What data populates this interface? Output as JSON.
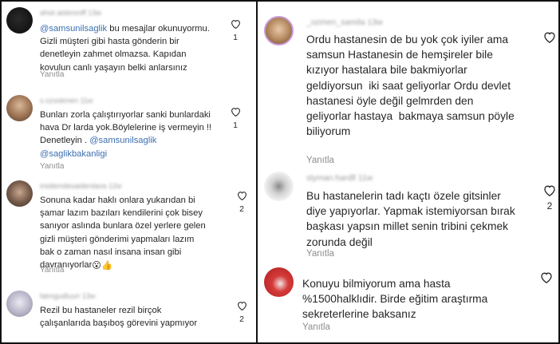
{
  "left_panel": {
    "comments": [
      {
        "username": "ahsir.aisbroniff  13w",
        "lines": [
          [
            {
              "t": "@samsunilsaglik",
              "m": true
            },
            {
              "t": " bu mesajlar okunuyormu."
            }
          ],
          [
            {
              "t": "Gizli müşteri gibi hasta gönderin bir"
            }
          ],
          [
            {
              "t": "denetleyin zahmet olmazsa. Kapıdan"
            }
          ],
          [
            {
              "t": "kovulun canlı yaşayın belki anlarsınız"
            }
          ]
        ],
        "reply": "Yanıtla",
        "likes": "1"
      },
      {
        "username": "s.ozsokmen  11w",
        "lines": [
          [
            {
              "t": "Bunları zorla çalıştırıyorlar sanki bunlardaki"
            }
          ],
          [
            {
              "t": "hava Dr larda yok.Böylelerine iş vermeyin !!"
            }
          ],
          [
            {
              "t": "Denetleyin . "
            },
            {
              "t": "@samsunilsaglik",
              "m": true
            }
          ],
          [
            {
              "t": "@saglikbakanligi",
              "m": true
            }
          ]
        ],
        "reply": "Yanıtla",
        "likes": "1"
      },
      {
        "username": "irsidemdesaiderdaoa  12w",
        "lines": [
          [
            {
              "t": "Sonuna kadar haklı onlara yukarıdan bi"
            }
          ],
          [
            {
              "t": "şamar lazım bazıları kendilerini çok bisey"
            }
          ],
          [
            {
              "t": "sanıyor aslında bunlara özel yerlere gelen"
            }
          ],
          [
            {
              "t": "gizli müşteri gönderimi yapmaları lazım"
            }
          ],
          [
            {
              "t": "bak o zaman nasıl insana insan gibi"
            }
          ],
          [
            {
              "t": "davranıyorlar"
            },
            {
              "t": "😮👍",
              "e": true
            }
          ]
        ],
        "reply": "Yanıtla",
        "likes": "2"
      },
      {
        "username": "fatmgudluurr  13w",
        "lines": [
          [
            {
              "t": "Rezil bu hastaneler rezil birçok"
            }
          ],
          [
            {
              "t": "çalışanlarıda başıboş görevini yapmıyor"
            }
          ]
        ],
        "reply": "Yanıtla",
        "likes": "2"
      }
    ]
  },
  "right_panel": {
    "comments": [
      {
        "username": "_ozmen_samila  13w",
        "lines": [
          [
            {
              "t": "Ordu hastanesin de bu yok çok iyiler ama"
            }
          ],
          [
            {
              "t": "samsun Hastanesin de hemşireler bile"
            }
          ],
          [
            {
              "t": "kızıyor hastalara bile bakmiyorlar"
            }
          ],
          [
            {
              "t": "geldiyorsun  iki saat geliyorlar Ordu devlet"
            }
          ],
          [
            {
              "t": "hastanesi öyle değil gelmrden den"
            }
          ],
          [
            {
              "t": "geliyorlar hastaya  bakmaya samsun pöyle"
            }
          ],
          [
            {
              "t": "biliyorum"
            }
          ]
        ],
        "reply": "Yanıtla",
        "likes": ""
      },
      {
        "username": "slyman.hardll  11w",
        "lines": [
          [
            {
              "t": "Bu hastanelerin tadı kaçtı özele gitsinler"
            }
          ],
          [
            {
              "t": "diye yapıyorlar. Yapmak istemiyorsan bırak"
            }
          ],
          [
            {
              "t": "başkası yapsın millet senin tribini çekmek"
            }
          ],
          [
            {
              "t": "zorunda değil"
            }
          ]
        ],
        "reply": "Yanıtla",
        "likes": "2"
      },
      {
        "username": "",
        "lines": [
          [
            {
              "t": "Konuyu bilmiyorum ama hasta"
            }
          ],
          [
            {
              "t": "%1500halklıdir. Birde eğitim araştırma"
            }
          ],
          [
            {
              "t": "sekreterlerine baksanız"
            }
          ]
        ],
        "reply": "Yanıtla",
        "likes": ""
      }
    ]
  }
}
